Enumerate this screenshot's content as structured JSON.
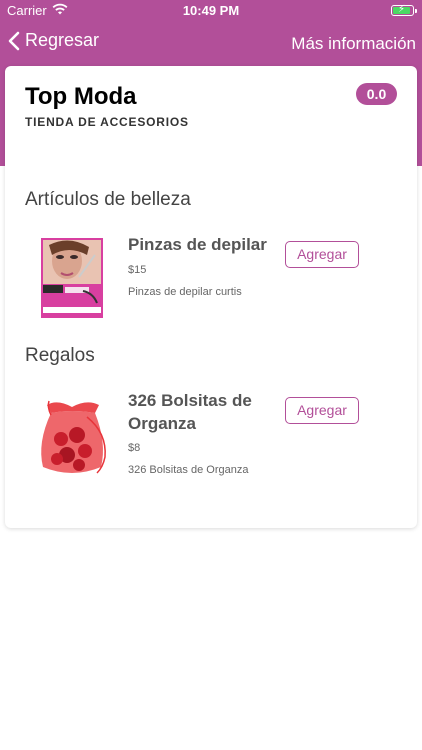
{
  "status_bar": {
    "carrier": "Carrier",
    "time": "10:49 PM"
  },
  "nav": {
    "back_label": "Regresar",
    "more_label": "Más información"
  },
  "store": {
    "name": "Top Moda",
    "subtitle": "TIENDA DE ACCESORIOS",
    "cart_total": "0.0"
  },
  "sections": [
    {
      "title": "Artículos de belleza",
      "products": [
        {
          "name": "Pinzas de depilar",
          "price": "$15",
          "description": "Pinzas de depilar curtis",
          "add_label": "Agregar"
        }
      ]
    },
    {
      "title": "Regalos",
      "products": [
        {
          "name": "326 Bolsitas de Organza",
          "price": "$8",
          "description": "326 Bolsitas de Organza",
          "add_label": "Agregar"
        }
      ]
    }
  ],
  "colors": {
    "accent": "#b24f99",
    "battery": "#4cd964"
  }
}
